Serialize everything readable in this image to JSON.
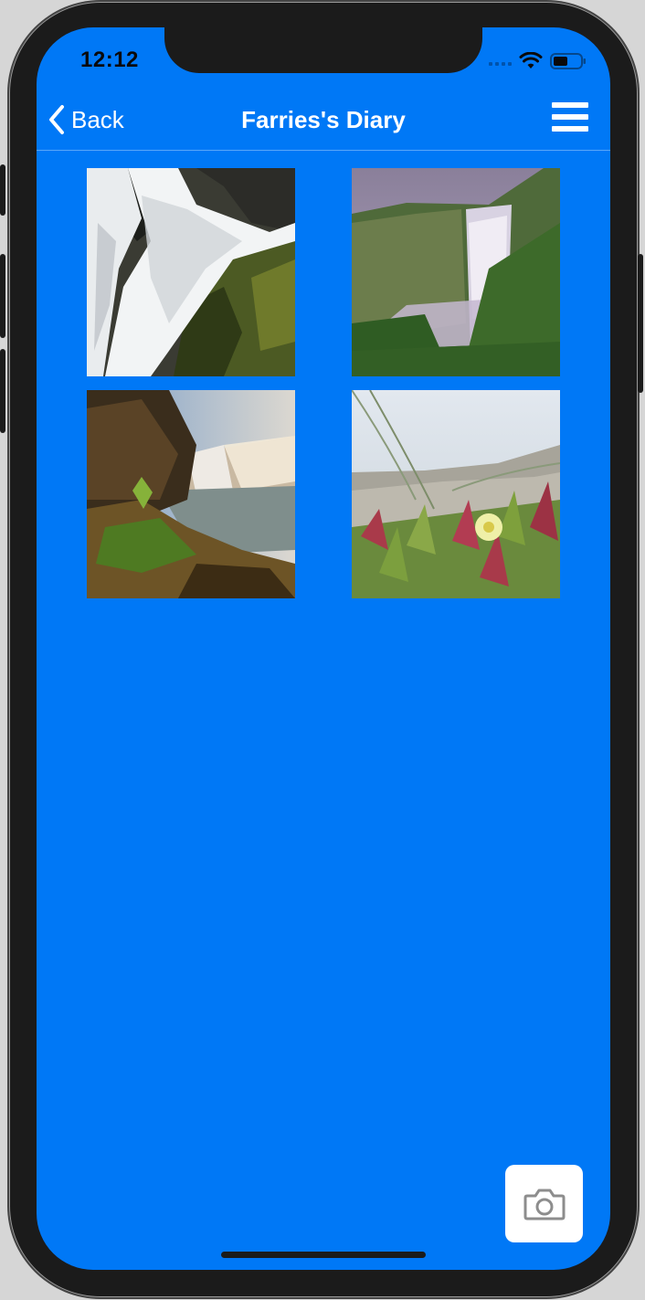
{
  "status_bar": {
    "time": "12:12"
  },
  "navbar": {
    "back_label": "Back",
    "title": "Farries's Diary"
  },
  "gallery": {
    "photos": [
      {
        "subject": "waterfall-closeup-rocks"
      },
      {
        "subject": "waterfall-green-cliffs-mist"
      },
      {
        "subject": "waterfall-mossy-rocks-sunlight"
      },
      {
        "subject": "ice-plant-flower-dunes"
      }
    ]
  },
  "colors": {
    "background": "#0078f6",
    "accent": "#ffffff",
    "device_frame": "#1b1b1b"
  },
  "icons": {
    "back": "chevron-left-icon",
    "menu": "hamburger-menu-icon",
    "camera": "camera-icon",
    "wifi": "wifi-icon",
    "battery": "battery-icon"
  }
}
